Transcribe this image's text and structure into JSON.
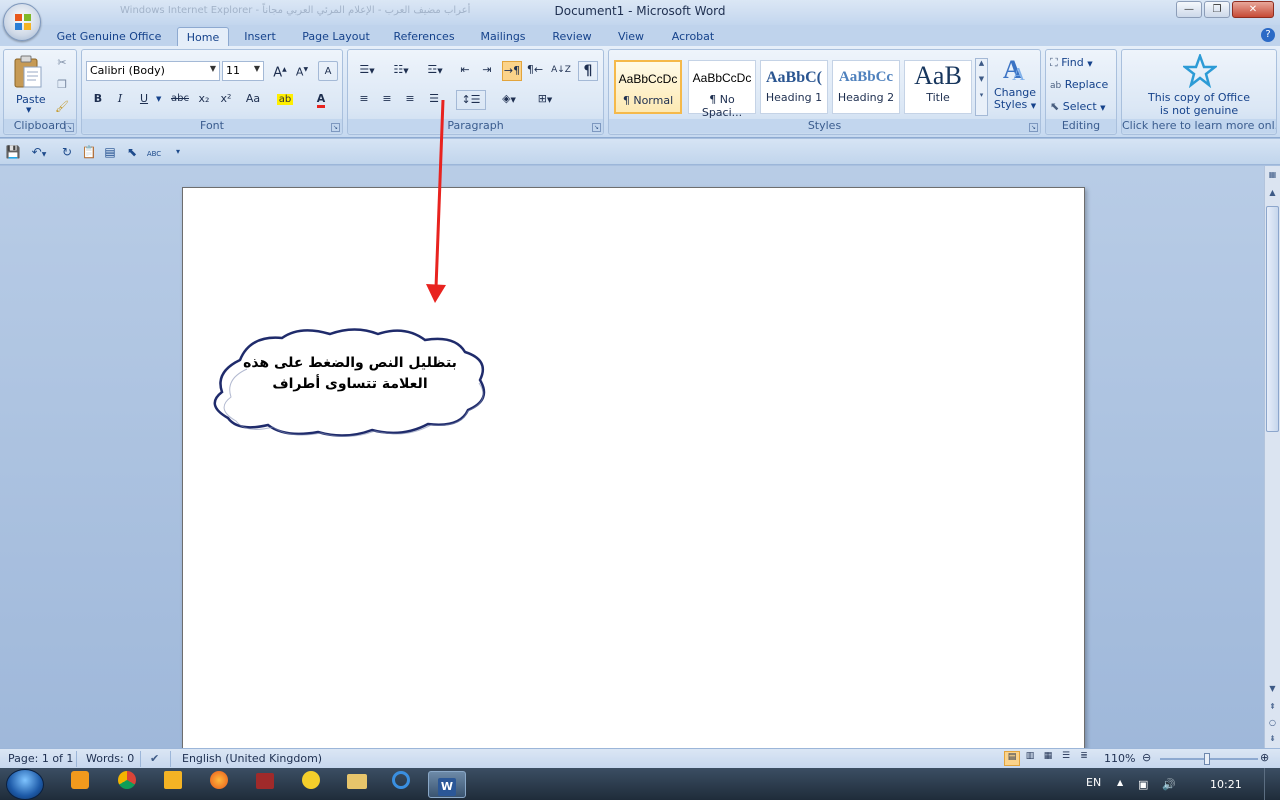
{
  "window": {
    "title": "Document1 - Microsoft Word",
    "background_title": "أعراب مضيف العرب - الإعلام المرئي العربي مجاناً - Windows Internet Explorer",
    "minimize": "—",
    "maximize": "❐",
    "close": "✕"
  },
  "tabs": [
    "Get Genuine Office",
    "Home",
    "Insert",
    "Page Layout",
    "References",
    "Mailings",
    "Review",
    "View",
    "Acrobat"
  ],
  "active_tab": "Home",
  "help_label": "?",
  "clipboard": {
    "label": "Clipboard",
    "paste_label": "Paste",
    "icons": [
      "clipboard-icon",
      "scissors-icon",
      "copy-icon",
      "format-painter-icon"
    ]
  },
  "font": {
    "label": "Font",
    "font_name": "Calibri (Body)",
    "font_size": "11",
    "buttons": [
      "B",
      "I",
      "U",
      "abc",
      "x₂",
      "x²",
      "Aa"
    ],
    "grow_label": "A",
    "shrink_label": "A",
    "clear_label": "A"
  },
  "paragraph": {
    "label": "Paragraph",
    "sort_label": "A↓Z",
    "pilcrow": "¶"
  },
  "styles": {
    "label": "Styles",
    "items": [
      {
        "sample": "AaBbCcDc",
        "name": "¶ Normal"
      },
      {
        "sample": "AaBbCcDc",
        "name": "¶ No Spaci..."
      },
      {
        "sample": "AaBbC(",
        "name": "Heading 1"
      },
      {
        "sample": "AaBbCc",
        "name": "Heading 2"
      },
      {
        "sample": "AaB",
        "name": "Title"
      }
    ],
    "change_label_1": "Change",
    "change_label_2": "Styles",
    "accent_color": "#f5b94a"
  },
  "editing": {
    "label": "Editing",
    "find": "Find",
    "replace": "Replace",
    "select": "Select"
  },
  "genuine": {
    "line1": "This copy of Office",
    "line2": "is not genuine",
    "link": "Click here to learn more onl..."
  },
  "callout": {
    "line1": "بتظليل النص والضغط على هذه",
    "line2": "العلامة تتساوى أطراف",
    "arrow_color": "#e8231f"
  },
  "status": {
    "page": "Page: 1 of 1",
    "words": "Words: 0",
    "language": "English (United Kingdom)",
    "zoom": "110%"
  },
  "taskbar": {
    "language": "EN",
    "time": "10:21"
  }
}
